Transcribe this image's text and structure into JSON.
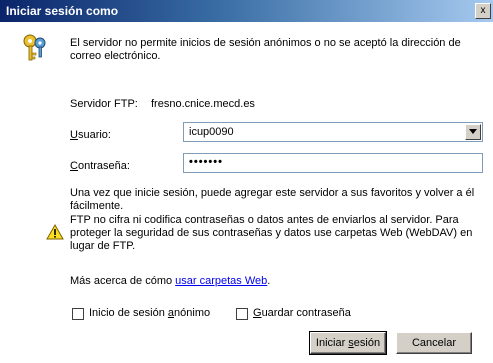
{
  "window": {
    "title": "Iniciar sesión como",
    "close_glyph": "x"
  },
  "message": "El servidor no permite inicios de sesión anónimos o no se aceptó la  dirección de correo electrónico.",
  "ftp": {
    "label": "Servidor FTP:",
    "value": "fresno.cnice.mecd.es"
  },
  "user": {
    "label_u": "U",
    "label_rest": "suario:",
    "value": "icup0090"
  },
  "password": {
    "label_c": "C",
    "label_rest": "ontraseña:",
    "masked_value": "•••••••"
  },
  "info": {
    "line1": "Una vez que inicie sesión, puede agregar este servidor a sus favoritos y volver a él fácilmente.",
    "line2": "FTP no cifra ni codifica contraseñas o datos antes de enviarlos al servidor.  Para proteger la seguridad de sus contraseñas y datos use carpetas Web (WebDAV) en lugar de FTP."
  },
  "more": {
    "prefix": "Más acerca de cómo ",
    "link": "usar carpetas Web",
    "suffix": "."
  },
  "options": {
    "anon_prefix": "Inicio de sesión ",
    "anon_u": "a",
    "anon_rest": "nónimo",
    "save_g": "G",
    "save_rest": "uardar contraseña"
  },
  "buttons": {
    "login_prefix": "Iniciar ",
    "login_u": "s",
    "login_rest": "esión",
    "cancel": "Cancelar"
  },
  "icons": {
    "key": "key-icon",
    "warning": "warning-icon",
    "dropdown": "chevron-down-icon"
  }
}
